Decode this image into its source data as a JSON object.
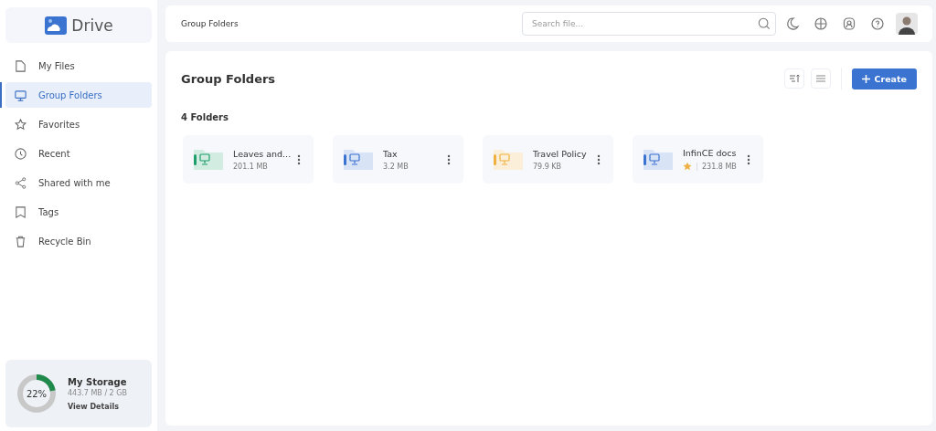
{
  "app": {
    "name": "Drive"
  },
  "sidebar": {
    "items": [
      {
        "label": "My Files",
        "selected": false
      },
      {
        "label": "Group Folders",
        "selected": true
      },
      {
        "label": "Favorites",
        "selected": false
      },
      {
        "label": "Recent",
        "selected": false
      },
      {
        "label": "Shared with me",
        "selected": false
      },
      {
        "label": "Tags",
        "selected": false
      },
      {
        "label": "Recycle Bin",
        "selected": false
      }
    ]
  },
  "storage": {
    "percent": "22%",
    "level": 0.22,
    "title": "My Storage",
    "usage": "443.7 MB / 2 GB",
    "link": "View Details"
  },
  "topbar": {
    "breadcrumb": "Group Folders",
    "search": {
      "placeholder": "Search file..."
    }
  },
  "content": {
    "title": "Group Folders",
    "create_label": "Create",
    "count": "4 Folders",
    "folders": [
      {
        "name": "Leaves and...",
        "size": "201.1 MB",
        "color": "#1e9e6a",
        "favorite": false
      },
      {
        "name": "Tax",
        "size": "3.2 MB",
        "color": "#3b73d1",
        "favorite": false
      },
      {
        "name": "Travel Policy",
        "size": "79.9 KB",
        "color": "#f0b03f",
        "favorite": false
      },
      {
        "name": "InfinCE docs",
        "size": "231.8 MB",
        "color": "#3b73d1",
        "favorite": true
      }
    ]
  }
}
